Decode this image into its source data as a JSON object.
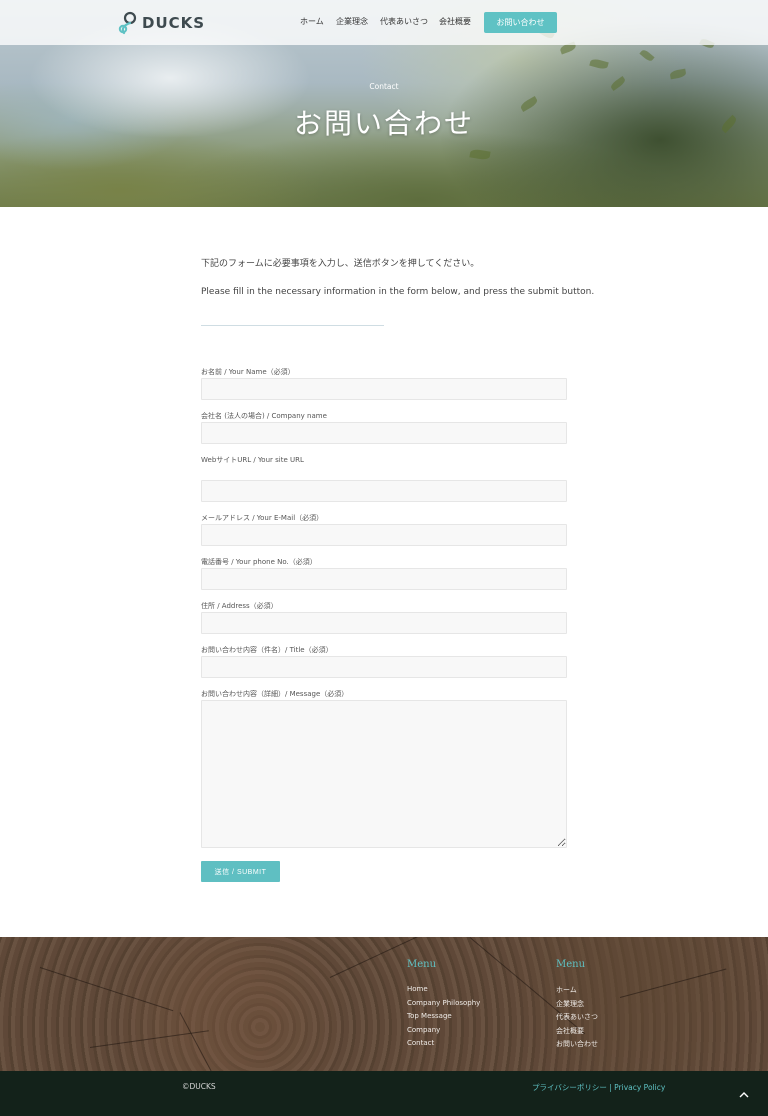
{
  "brand": {
    "name": "DUCKS",
    "accent": "#5fc2c4"
  },
  "nav": {
    "items": [
      "ホーム",
      "企業理念",
      "代表あいさつ",
      "会社概要"
    ],
    "cta": "お問い合わせ"
  },
  "hero": {
    "subtitle": "Contact",
    "title": "お問い合わせ"
  },
  "intro": {
    "ja": "下記のフォームに必要事項を入力し、送信ボタンを押してください。",
    "en": "Please fill in the necessary information in the form below, and press the submit button."
  },
  "form": {
    "fields": [
      {
        "label": "お名前 / Your Name（必須）",
        "value": ""
      },
      {
        "label": "会社名 (法人の場合) / Company name",
        "value": ""
      },
      {
        "label": "WebサイトURL / Your site URL",
        "value": ""
      },
      {
        "label": "メールアドレス / Your E-Mail（必須）",
        "value": ""
      },
      {
        "label": "電話番号 / Your phone No.（必須）",
        "value": ""
      },
      {
        "label": "住所 / Address（必須）",
        "value": ""
      },
      {
        "label": "お問い合わせ内容（件名）/ Title（必須）",
        "value": ""
      }
    ],
    "message_label": "お問い合わせ内容（詳細）/ Message（必須）",
    "submit": "送信 / SUBMIT"
  },
  "footer": {
    "columns": [
      {
        "heading": "Menu",
        "links": [
          "Home",
          "Company Philosophy",
          "Top Message",
          "Company",
          "Contact"
        ]
      },
      {
        "heading": "Menu",
        "links": [
          "ホーム",
          "企業理念",
          "代表あいさつ",
          "会社概要",
          "お問い合わせ"
        ]
      }
    ],
    "copyright": "©DUCKS",
    "policy": "プライバシーポリシー | Privacy Policy",
    "to_top_icon": "chevron-up-icon"
  }
}
